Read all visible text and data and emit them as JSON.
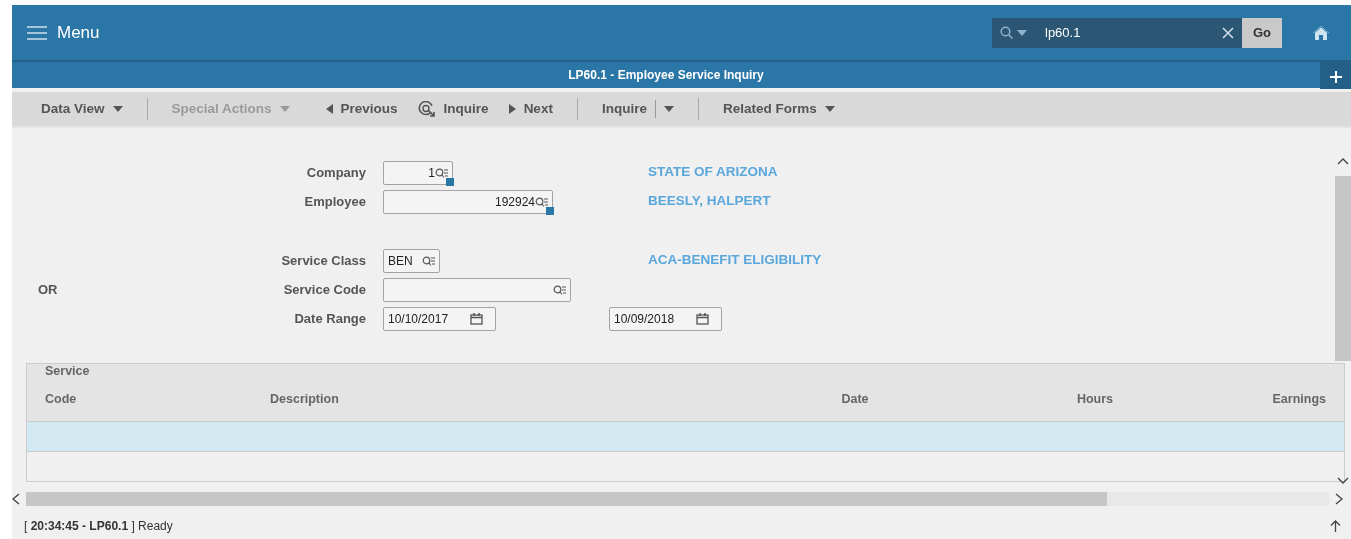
{
  "header": {
    "menu_label": "Menu",
    "search": {
      "value": "lp60.1",
      "button": "Go"
    }
  },
  "form_title": "LP60.1 - Employee Service Inquiry",
  "toolbar": [
    {
      "label": "Data View",
      "kind": "dropdown",
      "disabled": false
    },
    {
      "label": "Special Actions",
      "kind": "dropdown",
      "disabled": true
    },
    {
      "label": "Previous",
      "kind": "prev",
      "disabled": false
    },
    {
      "label": "Inquire",
      "kind": "inquire",
      "disabled": false
    },
    {
      "label": "Next",
      "kind": "next",
      "disabled": false
    },
    {
      "label": "Inquire",
      "kind": "split",
      "disabled": false
    },
    {
      "label": "Related Forms",
      "kind": "dropdown",
      "disabled": false
    }
  ],
  "fields": [
    {
      "label": "Company",
      "value": "1",
      "kind": "lookup",
      "required": true,
      "description": "STATE OF ARIZONA"
    },
    {
      "label": "Employee",
      "value": "192924",
      "kind": "lookup",
      "required": true,
      "description": "BEESLY, HALPERT"
    },
    {
      "kind": "spacer"
    },
    {
      "label": "Service Class",
      "value": "BEN",
      "kind": "lookup",
      "required": false,
      "description": "ACA-BENEFIT ELIGIBILITY"
    },
    {
      "label": "Service Code",
      "kind": "lookup",
      "required": false,
      "prefix": "OR"
    },
    {
      "label": "Date Range",
      "kind": "daterange",
      "from": "10/10/2017",
      "to": "10/09/2018"
    }
  ],
  "table": {
    "columns": [
      {
        "label": "Service\nCode"
      },
      {
        "label": "Description"
      },
      {
        "label": "Date"
      },
      {
        "label": "Hours"
      },
      {
        "label": "Earnings"
      }
    ],
    "rows": [
      {
        "selected": true
      },
      {
        "selected": false
      }
    ]
  },
  "status_bar": "[ **20:34:45 - LP60.1** ] Ready"
}
